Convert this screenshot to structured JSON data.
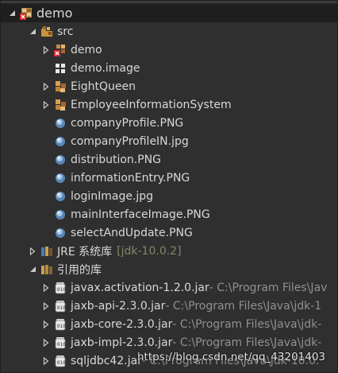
{
  "tree": {
    "project": {
      "label": "demo"
    },
    "src": {
      "label": "src"
    },
    "packages": {
      "demo": "demo",
      "demo_image": "demo.image",
      "eight_queen": "EightQueen",
      "employee": "EmployeeInformationSystem"
    },
    "files": [
      "companyProfile.PNG",
      "companyProfileIN.jpg",
      "distribution.PNG",
      "informationEntry.PNG",
      "loginImage.jpg",
      "mainInterfaceImage.PNG",
      "selectAndUpdate.PNG"
    ],
    "jre": {
      "label": "JRE 系统库",
      "version": "[jdk-10.0.2]"
    },
    "libs": {
      "label": "引用的库",
      "jars": [
        {
          "name": "javax.activation-1.2.0.jar",
          "path": " - C:\\Program Files\\Jav"
        },
        {
          "name": "jaxb-api-2.3.0.jar",
          "path": " - C:\\Program Files\\Java\\jdk-1"
        },
        {
          "name": "jaxb-core-2.3.0.jar",
          "path": " - C:\\Program Files\\Java\\jdk-"
        },
        {
          "name": "jaxb-impl-2.3.0.jar",
          "path": " - C:\\Program Files\\Java\\jdk-"
        },
        {
          "name": "sqljdbc42.jar",
          "path": " - C:\\Program Files\\Java\\jdk-10.0."
        }
      ]
    }
  },
  "watermark": "https://blog.csdn.net/qq_43201403",
  "colors": {
    "background": "#2f2f2f",
    "selected_row": "#1f1f1f",
    "text": "#d8d8d8",
    "decoration": "#909090"
  }
}
